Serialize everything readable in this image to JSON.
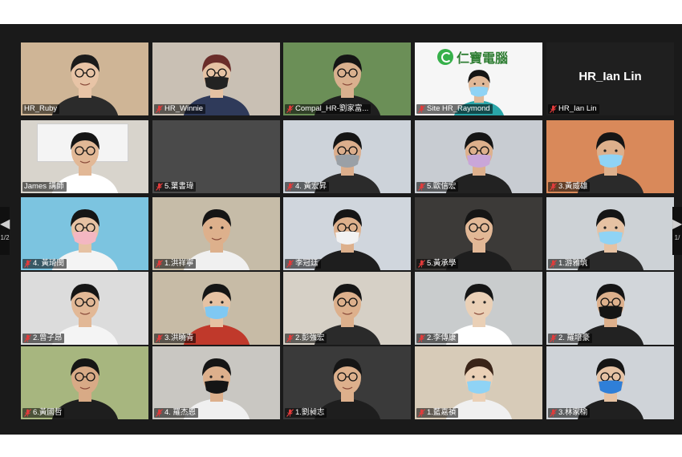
{
  "meeting": {
    "pager": {
      "current": "1/2",
      "left_glyph": "◀",
      "right_glyph": "▶",
      "right_label": "1/"
    },
    "logo_text": "仁寶電腦",
    "participants": [
      {
        "name": "HR_Ruby",
        "muted": false,
        "active": true,
        "video": true,
        "bg": "#cfb596",
        "shirt": "#2b2b2b",
        "skin": "#e8c4a6",
        "hair": "#1b1b1b",
        "mask": null,
        "glasses": true
      },
      {
        "name": "HR_Winnie",
        "muted": true,
        "video": true,
        "bg": "#c9c0b4",
        "shirt": "#2f3a5a",
        "skin": "#e6c2a3",
        "hair": "#6a2d2a",
        "mask": "#222222",
        "glasses": true
      },
      {
        "name": "Compal_HR-劉家富...",
        "muted": true,
        "video": true,
        "bg": "#6b8f57",
        "shirt": "#1f1f1f",
        "skin": "#d9b08e",
        "hair": "#151515",
        "mask": null,
        "glasses": true
      },
      {
        "name": "Site HR_Raymond",
        "muted": true,
        "video": true,
        "bg": "#f6f6f6",
        "shirt": "#2aa6a9",
        "skin": "#e0b898",
        "hair": "#151515",
        "mask": "#8fd3f5",
        "glasses": false,
        "logo": true
      },
      {
        "name": "HR_Ian Lin",
        "muted": true,
        "video": false
      },
      {
        "name": "James 講師",
        "muted": false,
        "video": true,
        "bg": "#d8d4cc",
        "shirt": "#ffffff",
        "skin": "#e2b896",
        "hair": "#151515",
        "mask": null,
        "glasses": true,
        "whiteboard": true
      },
      {
        "name": "5.葉書瑋",
        "muted": true,
        "video": true,
        "bg": "#4a4a4a",
        "empty": true
      },
      {
        "name": "4. 黃宏昇",
        "muted": true,
        "video": true,
        "bg": "#cdd3da",
        "shirt": "#2b2b2b",
        "skin": "#dcae8c",
        "hair": "#151515",
        "mask": "#9aa0a6",
        "glasses": true
      },
      {
        "name": "5.歐信宏",
        "muted": true,
        "video": true,
        "bg": "#c8ccd2",
        "shirt": "#222222",
        "skin": "#ddb08c",
        "hair": "#151515",
        "mask": "#c9a6d8",
        "glasses": true
      },
      {
        "name": "3.黃威雄",
        "muted": true,
        "video": true,
        "bg": "#d9895a",
        "shirt": "#2a2a2a",
        "skin": "#ddb08c",
        "hair": "#151515",
        "mask": "#8fd3f5",
        "glasses": false
      },
      {
        "name": "4. 黃琦閔",
        "muted": true,
        "video": true,
        "bg": "#7cc4e0",
        "shirt": "#f4f4f4",
        "skin": "#e6c2a3",
        "hair": "#151515",
        "mask": "#f3b7c2",
        "glasses": true
      },
      {
        "name": "1.洪祥寧",
        "muted": true,
        "video": true,
        "bg": "#c6bca8",
        "shirt": "#f0f0f0",
        "skin": "#ddb08c",
        "hair": "#151515",
        "mask": null,
        "glasses": false
      },
      {
        "name": "李冠廷",
        "muted": true,
        "video": true,
        "bg": "#d0d6dd",
        "shirt": "#1e1e1e",
        "skin": "#ddb08c",
        "hair": "#151515",
        "mask": "#f2f2f2",
        "glasses": true
      },
      {
        "name": "5.黃承學",
        "muted": true,
        "video": true,
        "bg": "#3c3a38",
        "shirt": "#1e1e1e",
        "skin": "#e2b896",
        "hair": "#151515",
        "mask": null,
        "glasses": true
      },
      {
        "name": "1.游雅筑",
        "muted": true,
        "video": true,
        "bg": "#cdd2d6",
        "shirt": "#2a2a2a",
        "skin": "#e6c2a3",
        "hair": "#151515",
        "mask": "#8fd3f5",
        "glasses": false
      },
      {
        "name": "2.曾子昂",
        "muted": true,
        "video": true,
        "bg": "#dcdcdc",
        "shirt": "#f4f4f4",
        "skin": "#e2b896",
        "hair": "#151515",
        "mask": null,
        "glasses": true,
        "window": true
      },
      {
        "name": "3.洪曉青",
        "muted": true,
        "video": true,
        "bg": "#c7bba6",
        "shirt": "#c0392b",
        "skin": "#e6c2a3",
        "hair": "#151515",
        "mask": "#7fc8f2",
        "glasses": false
      },
      {
        "name": "2.彭強宏",
        "muted": true,
        "video": true,
        "bg": "#d6d0c6",
        "shirt": "#2a2a2a",
        "skin": "#ddb08c",
        "hair": "#151515",
        "mask": null,
        "glasses": true
      },
      {
        "name": "2.李傳康",
        "muted": true,
        "video": true,
        "bg": "#c9cccd",
        "shirt": "#ffffff",
        "skin": "#ead0b6",
        "hair": "#151515",
        "mask": null,
        "glasses": false
      },
      {
        "name": "2. 羅培豪",
        "muted": true,
        "video": true,
        "bg": "#d2d6da",
        "shirt": "#222222",
        "skin": "#ddb08c",
        "hair": "#151515",
        "mask": "#151515",
        "glasses": true
      },
      {
        "name": "6.黃國哲",
        "muted": true,
        "video": true,
        "bg": "#a7b67f",
        "shirt": "#1e1e1e",
        "skin": "#d8aa86",
        "hair": "#151515",
        "mask": null,
        "glasses": true
      },
      {
        "name": "4. 羅杰恩",
        "muted": true,
        "video": true,
        "bg": "#c9c7c2",
        "shirt": "#f0f0f0",
        "skin": "#ddb08c",
        "hair": "#151515",
        "mask": "#151515",
        "glasses": false
      },
      {
        "name": "1.劉昶志",
        "muted": true,
        "video": true,
        "bg": "#3a3a3a",
        "shirt": "#1e1e1e",
        "skin": "#ddb08c",
        "hair": "#151515",
        "mask": null,
        "glasses": true
      },
      {
        "name": "1.藍嘉禎",
        "muted": true,
        "video": true,
        "bg": "#d7cbb8",
        "shirt": "#f0f0f0",
        "skin": "#ead0b6",
        "hair": "#3a2418",
        "mask": "#8fd3f5",
        "glasses": false
      },
      {
        "name": "3.林家榆",
        "muted": true,
        "video": true,
        "bg": "#cfd3d8",
        "shirt": "#202020",
        "skin": "#e6c2a3",
        "hair": "#151515",
        "mask": "#2f7fd8",
        "glasses": true
      }
    ]
  }
}
